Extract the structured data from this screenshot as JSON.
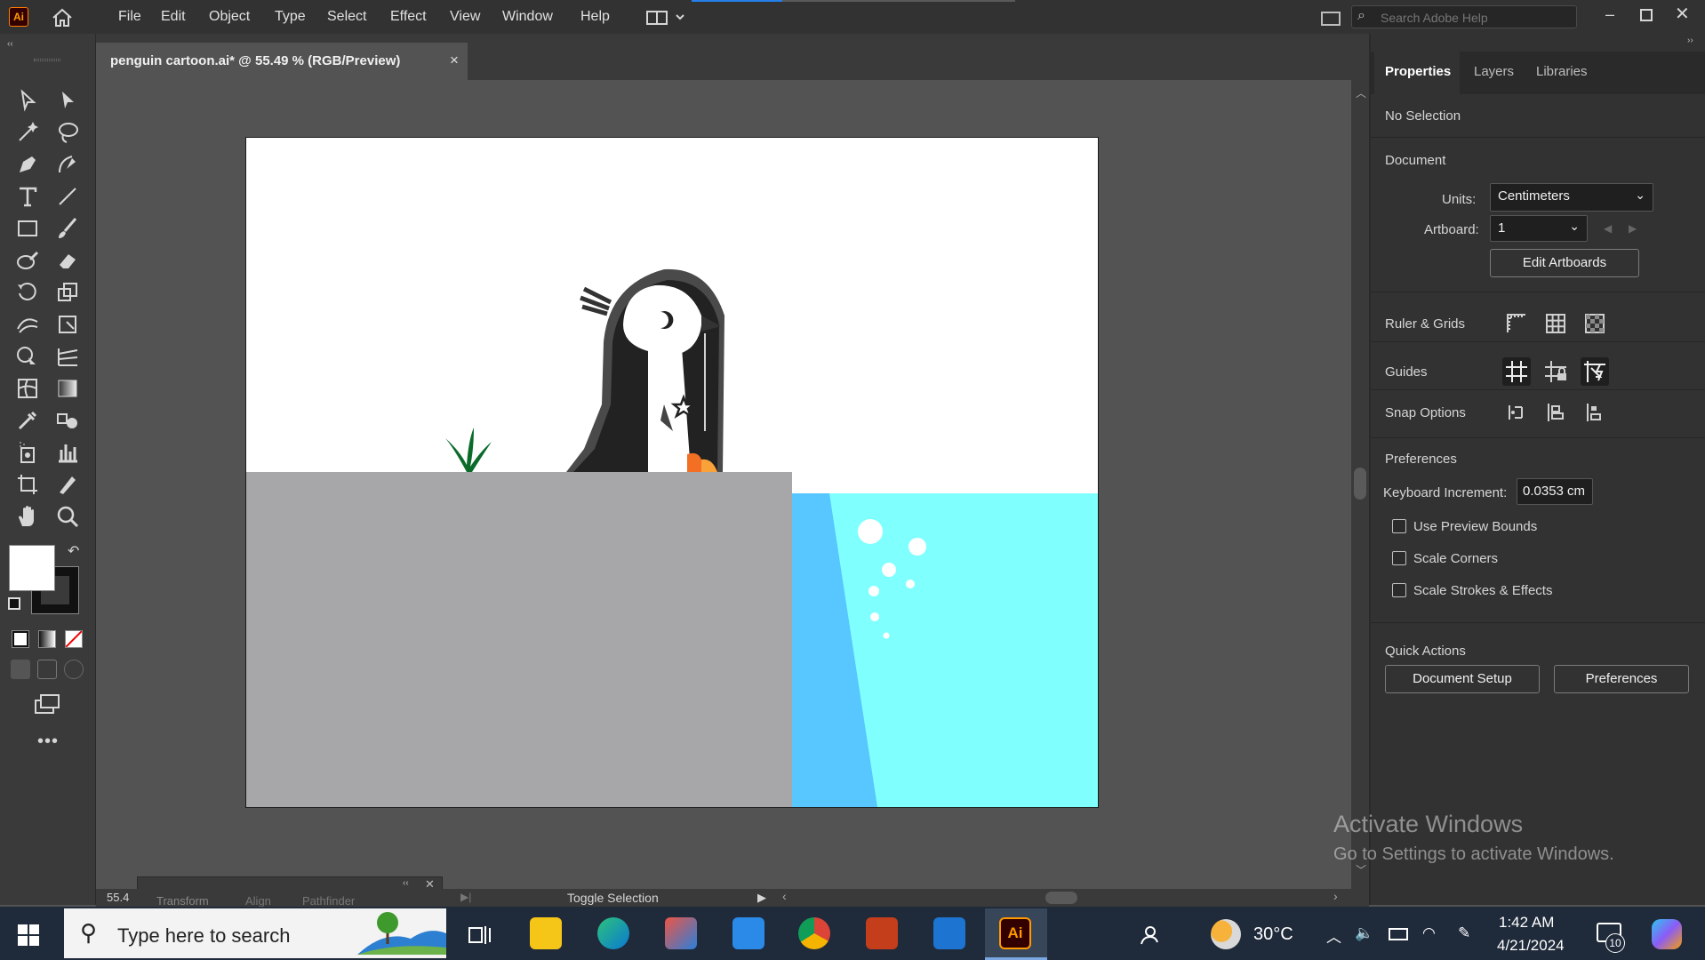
{
  "app": {
    "logo_text": "Ai"
  },
  "menu": [
    "File",
    "Edit",
    "Object",
    "Type",
    "Select",
    "Effect",
    "View",
    "Window",
    "Help"
  ],
  "search": {
    "placeholder": "Search Adobe Help"
  },
  "document": {
    "tab_title": "penguin cartoon.ai* @ 55.49 % (RGB/Preview)",
    "close": "×"
  },
  "panel": {
    "tabs": [
      "Properties",
      "Layers",
      "Libraries"
    ],
    "selection": "No Selection",
    "document_title": "Document",
    "units_label": "Units:",
    "units_value": "Centimeters",
    "artboard_label": "Artboard:",
    "artboard_value": "1",
    "edit_artboards": "Edit Artboards",
    "ruler_grids": "Ruler & Grids",
    "guides": "Guides",
    "snap_options": "Snap Options",
    "preferences_title": "Preferences",
    "keyboard_increment_label": "Keyboard Increment:",
    "keyboard_increment_value": "0.0353 cm",
    "checkboxes": [
      "Use Preview Bounds",
      "Scale Corners",
      "Scale Strokes & Effects"
    ],
    "quick_actions": "Quick Actions",
    "document_setup": "Document Setup",
    "preferences_btn": "Preferences"
  },
  "status": {
    "zoom": "55.4",
    "toggle_selection": "Toggle Selection",
    "mini_tabs": [
      "Transform",
      "Align",
      "Pathfinder"
    ]
  },
  "watermark": {
    "line1": "Activate Windows",
    "line2": "Go to Settings to activate Windows."
  },
  "taskbar": {
    "search_placeholder": "Type here to search",
    "temperature": "30°C",
    "time": "1:42 AM",
    "date": "4/21/2024",
    "notifications": "10"
  },
  "colors": {
    "app_bg": "#535353",
    "menubar": "#323232",
    "ice": "#a7a7aa",
    "water_light": "#80ffff",
    "water_deep": "#58c6ff",
    "penguin_dark": "#222222",
    "accent_orange": "#f36f24"
  }
}
